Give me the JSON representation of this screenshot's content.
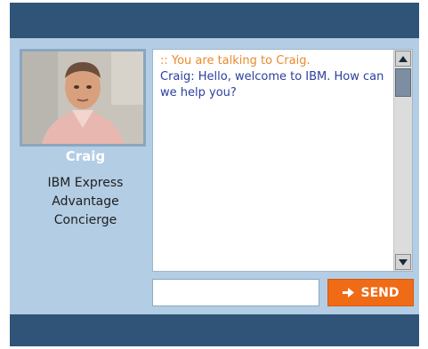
{
  "agent": {
    "name": "Craig",
    "title_lines": [
      "IBM Express",
      "Advantage",
      "Concierge"
    ]
  },
  "chat": {
    "messages": [
      {
        "kind": "system",
        "text": ":: You are talking to Craig."
      },
      {
        "kind": "agent",
        "text": "Craig: Hello, welcome to IBM.  How can we help you?"
      }
    ]
  },
  "composer": {
    "input_value": "",
    "send_label": "SEND",
    "send_icon": "arrow-right-icon"
  },
  "colors": {
    "bar": "#2f5478",
    "panel": "#b3cde4",
    "send_button": "#f06b16",
    "system_text": "#e98a2c",
    "agent_text": "#2b3f9e"
  }
}
